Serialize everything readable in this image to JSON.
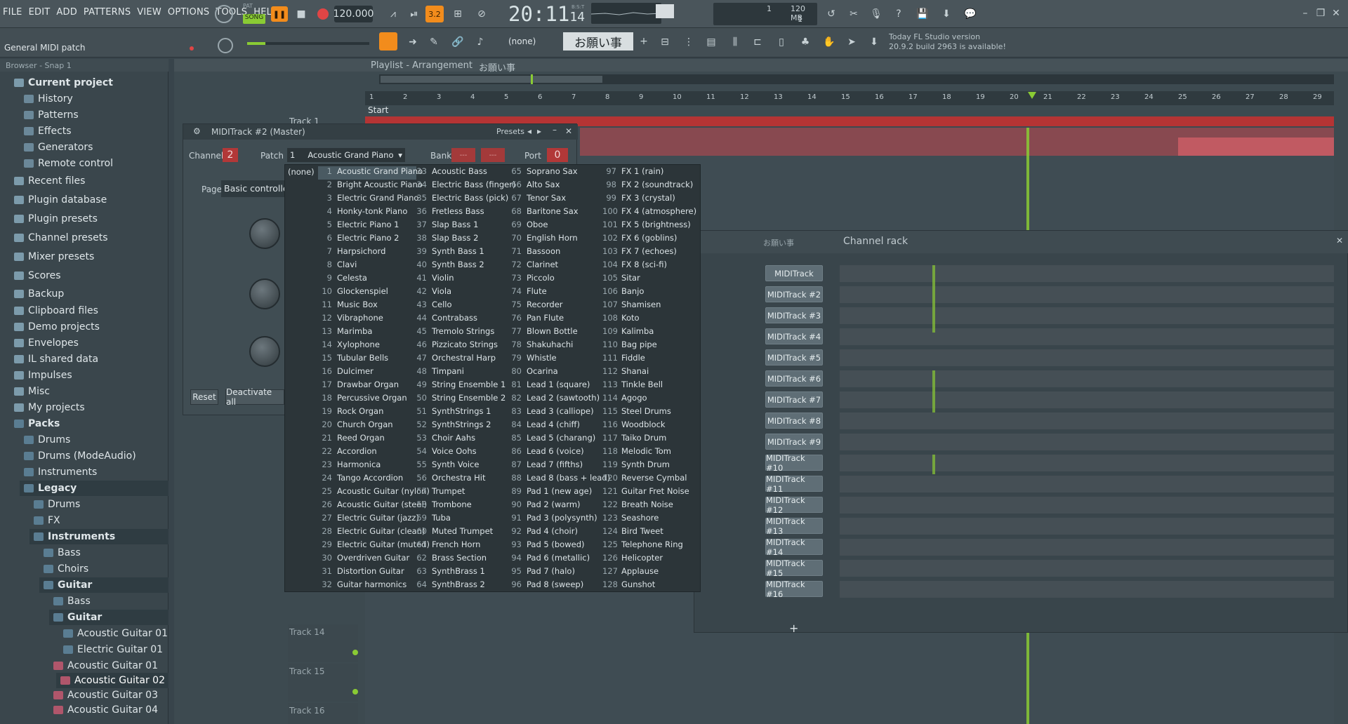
{
  "menu": [
    "FILE",
    "EDIT",
    "ADD",
    "PATTERNS",
    "VIEW",
    "OPTIONS",
    "TOOLS",
    "HELP"
  ],
  "transport": {
    "pat_label": "PAT",
    "song_label": "SONG",
    "tempo": "120.000",
    "time": "20:11",
    "time_small": "14",
    "time_label": "B:S:T",
    "cpu": "1",
    "mem": "120 MB",
    "poly": "1"
  },
  "hint": "General MIDI patch",
  "pattern_name": "お願い事",
  "none_selector": "(none)",
  "news": {
    "line1": "Today  FL Studio version",
    "line2": "20.9.2 build 2963 is available!"
  },
  "browser": {
    "header": "Browser - Snap 1",
    "items": [
      "Current project",
      "History",
      "Patterns",
      "Effects",
      "Generators",
      "Remote control",
      "Recent files",
      "Plugin database",
      "Plugin presets",
      "Channel presets",
      "Mixer presets",
      "Scores",
      "Backup",
      "Clipboard files",
      "Demo projects",
      "Envelopes",
      "IL shared data",
      "Impulses",
      "Misc",
      "My projects",
      "Packs",
      "Drums",
      "Drums (ModeAudio)",
      "Instruments",
      "Legacy",
      "Drums",
      "FX",
      "Instruments",
      "Bass",
      "Choirs",
      "Guitar",
      "Bass",
      "Guitar",
      "Acoustic Guitar 01",
      "Electric Guitar 01",
      "Acoustic Guitar 01",
      "Acoustic Guitar 02",
      "Acoustic Guitar 03",
      "Acoustic Guitar 04"
    ]
  },
  "playlist": {
    "title": "Playlist - Arrangement",
    "pattern": "お願い事",
    "start_marker": "Start",
    "track1": "Track 1",
    "ruler": [
      "1",
      "2",
      "3",
      "4",
      "5",
      "6",
      "7",
      "8",
      "9",
      "10",
      "11",
      "12",
      "13",
      "14",
      "15",
      "16",
      "17",
      "18",
      "19",
      "20",
      "21",
      "22",
      "23",
      "24",
      "25",
      "26",
      "27",
      "28",
      "29"
    ],
    "tracks": [
      "Track 14",
      "Track 15",
      "Track 16"
    ]
  },
  "midi_window": {
    "title": "MIDITrack #2 (Master)",
    "presets": "Presets",
    "channel_label": "Channel",
    "channel": "2",
    "patch_label": "Patch",
    "patch_num": "1",
    "patch_name": "Acoustic Grand Piano",
    "bank_label": "Bank",
    "bank1": "---",
    "bank2": "---",
    "port_label": "Port",
    "port": "0",
    "page_label": "Page",
    "page": "Basic controllers",
    "reset": "Reset",
    "deactivate": "Deactivate all"
  },
  "patches": {
    "none": "(none)",
    "col1": [
      [
        "1",
        "Acoustic Grand Piano"
      ],
      [
        "2",
        "Bright Acoustic Piano"
      ],
      [
        "3",
        "Electric Grand Piano"
      ],
      [
        "4",
        "Honky-tonk Piano"
      ],
      [
        "5",
        "Electric Piano 1"
      ],
      [
        "6",
        "Electric Piano 2"
      ],
      [
        "7",
        "Harpsichord"
      ],
      [
        "8",
        "Clavi"
      ],
      [
        "9",
        "Celesta"
      ],
      [
        "10",
        "Glockenspiel"
      ],
      [
        "11",
        "Music Box"
      ],
      [
        "12",
        "Vibraphone"
      ],
      [
        "13",
        "Marimba"
      ],
      [
        "14",
        "Xylophone"
      ],
      [
        "15",
        "Tubular Bells"
      ],
      [
        "16",
        "Dulcimer"
      ],
      [
        "17",
        "Drawbar Organ"
      ],
      [
        "18",
        "Percussive Organ"
      ],
      [
        "19",
        "Rock Organ"
      ],
      [
        "20",
        "Church Organ"
      ],
      [
        "21",
        "Reed Organ"
      ],
      [
        "22",
        "Accordion"
      ],
      [
        "23",
        "Harmonica"
      ],
      [
        "24",
        "Tango Accordion"
      ],
      [
        "25",
        "Acoustic Guitar (nylon)"
      ],
      [
        "26",
        "Acoustic Guitar (steel)"
      ],
      [
        "27",
        "Electric Guitar (jazz)"
      ],
      [
        "28",
        "Electric Guitar (clean)"
      ],
      [
        "29",
        "Electric Guitar (muted)"
      ],
      [
        "30",
        "Overdriven Guitar"
      ],
      [
        "31",
        "Distortion Guitar"
      ],
      [
        "32",
        "Guitar harmonics"
      ]
    ],
    "col2": [
      [
        "33",
        "Acoustic Bass"
      ],
      [
        "34",
        "Electric Bass (finger)"
      ],
      [
        "35",
        "Electric Bass (pick)"
      ],
      [
        "36",
        "Fretless Bass"
      ],
      [
        "37",
        "Slap Bass 1"
      ],
      [
        "38",
        "Slap Bass 2"
      ],
      [
        "39",
        "Synth Bass 1"
      ],
      [
        "40",
        "Synth Bass 2"
      ],
      [
        "41",
        "Violin"
      ],
      [
        "42",
        "Viola"
      ],
      [
        "43",
        "Cello"
      ],
      [
        "44",
        "Contrabass"
      ],
      [
        "45",
        "Tremolo Strings"
      ],
      [
        "46",
        "Pizzicato Strings"
      ],
      [
        "47",
        "Orchestral Harp"
      ],
      [
        "48",
        "Timpani"
      ],
      [
        "49",
        "String Ensemble 1"
      ],
      [
        "50",
        "String Ensemble 2"
      ],
      [
        "51",
        "SynthStrings 1"
      ],
      [
        "52",
        "SynthStrings 2"
      ],
      [
        "53",
        "Choir Aahs"
      ],
      [
        "54",
        "Voice Oohs"
      ],
      [
        "55",
        "Synth Voice"
      ],
      [
        "56",
        "Orchestra Hit"
      ],
      [
        "57",
        "Trumpet"
      ],
      [
        "58",
        "Trombone"
      ],
      [
        "59",
        "Tuba"
      ],
      [
        "60",
        "Muted Trumpet"
      ],
      [
        "61",
        "French Horn"
      ],
      [
        "62",
        "Brass Section"
      ],
      [
        "63",
        "SynthBrass 1"
      ],
      [
        "64",
        "SynthBrass 2"
      ]
    ],
    "col3": [
      [
        "65",
        "Soprano Sax"
      ],
      [
        "66",
        "Alto Sax"
      ],
      [
        "67",
        "Tenor Sax"
      ],
      [
        "68",
        "Baritone Sax"
      ],
      [
        "69",
        "Oboe"
      ],
      [
        "70",
        "English Horn"
      ],
      [
        "71",
        "Bassoon"
      ],
      [
        "72",
        "Clarinet"
      ],
      [
        "73",
        "Piccolo"
      ],
      [
        "74",
        "Flute"
      ],
      [
        "75",
        "Recorder"
      ],
      [
        "76",
        "Pan Flute"
      ],
      [
        "77",
        "Blown Bottle"
      ],
      [
        "78",
        "Shakuhachi"
      ],
      [
        "79",
        "Whistle"
      ],
      [
        "80",
        "Ocarina"
      ],
      [
        "81",
        "Lead 1 (square)"
      ],
      [
        "82",
        "Lead 2 (sawtooth)"
      ],
      [
        "83",
        "Lead 3 (calliope)"
      ],
      [
        "84",
        "Lead 4 (chiff)"
      ],
      [
        "85",
        "Lead 5 (charang)"
      ],
      [
        "86",
        "Lead 6 (voice)"
      ],
      [
        "87",
        "Lead 7 (fifths)"
      ],
      [
        "88",
        "Lead 8 (bass + lead)"
      ],
      [
        "89",
        "Pad 1 (new age)"
      ],
      [
        "90",
        "Pad 2 (warm)"
      ],
      [
        "91",
        "Pad 3 (polysynth)"
      ],
      [
        "92",
        "Pad 4 (choir)"
      ],
      [
        "93",
        "Pad 5 (bowed)"
      ],
      [
        "94",
        "Pad 6 (metallic)"
      ],
      [
        "95",
        "Pad 7 (halo)"
      ],
      [
        "96",
        "Pad 8 (sweep)"
      ]
    ],
    "col4": [
      [
        "97",
        "FX 1 (rain)"
      ],
      [
        "98",
        "FX 2 (soundtrack)"
      ],
      [
        "99",
        "FX 3 (crystal)"
      ],
      [
        "100",
        "FX 4 (atmosphere)"
      ],
      [
        "101",
        "FX 5 (brightness)"
      ],
      [
        "102",
        "FX 6 (goblins)"
      ],
      [
        "103",
        "FX 7 (echoes)"
      ],
      [
        "104",
        "FX 8 (sci-fi)"
      ],
      [
        "105",
        "Sitar"
      ],
      [
        "106",
        "Banjo"
      ],
      [
        "107",
        "Shamisen"
      ],
      [
        "108",
        "Koto"
      ],
      [
        "109",
        "Kalimba"
      ],
      [
        "110",
        "Bag pipe"
      ],
      [
        "111",
        "Fiddle"
      ],
      [
        "112",
        "Shanai"
      ],
      [
        "113",
        "Tinkle Bell"
      ],
      [
        "114",
        "Agogo"
      ],
      [
        "115",
        "Steel Drums"
      ],
      [
        "116",
        "Woodblock"
      ],
      [
        "117",
        "Taiko Drum"
      ],
      [
        "118",
        "Melodic Tom"
      ],
      [
        "119",
        "Synth Drum"
      ],
      [
        "120",
        "Reverse Cymbal"
      ],
      [
        "121",
        "Guitar Fret Noise"
      ],
      [
        "122",
        "Breath Noise"
      ],
      [
        "123",
        "Seashore"
      ],
      [
        "124",
        "Bird Tweet"
      ],
      [
        "125",
        "Telephone Ring"
      ],
      [
        "126",
        "Helicopter"
      ],
      [
        "127",
        "Applause"
      ],
      [
        "128",
        "Gunshot"
      ]
    ]
  },
  "channel_rack": {
    "title": "Channel rack",
    "pattern": "お願い事",
    "add": "+",
    "channels": [
      "MIDITrack",
      "MIDITrack #2",
      "MIDITrack #3",
      "MIDITrack #4",
      "MIDITrack #5",
      "MIDITrack #6",
      "MIDITrack #7",
      "MIDITrack #8",
      "MIDITrack #9",
      "MIDITrack #10",
      "MIDITrack #11",
      "MIDITrack #12",
      "MIDITrack #13",
      "MIDITrack #14",
      "MIDITrack #15",
      "MIDITrack #16"
    ]
  },
  "colors": {
    "accent": "#f28c1c",
    "green": "#8acb34",
    "record": "#e04545"
  }
}
